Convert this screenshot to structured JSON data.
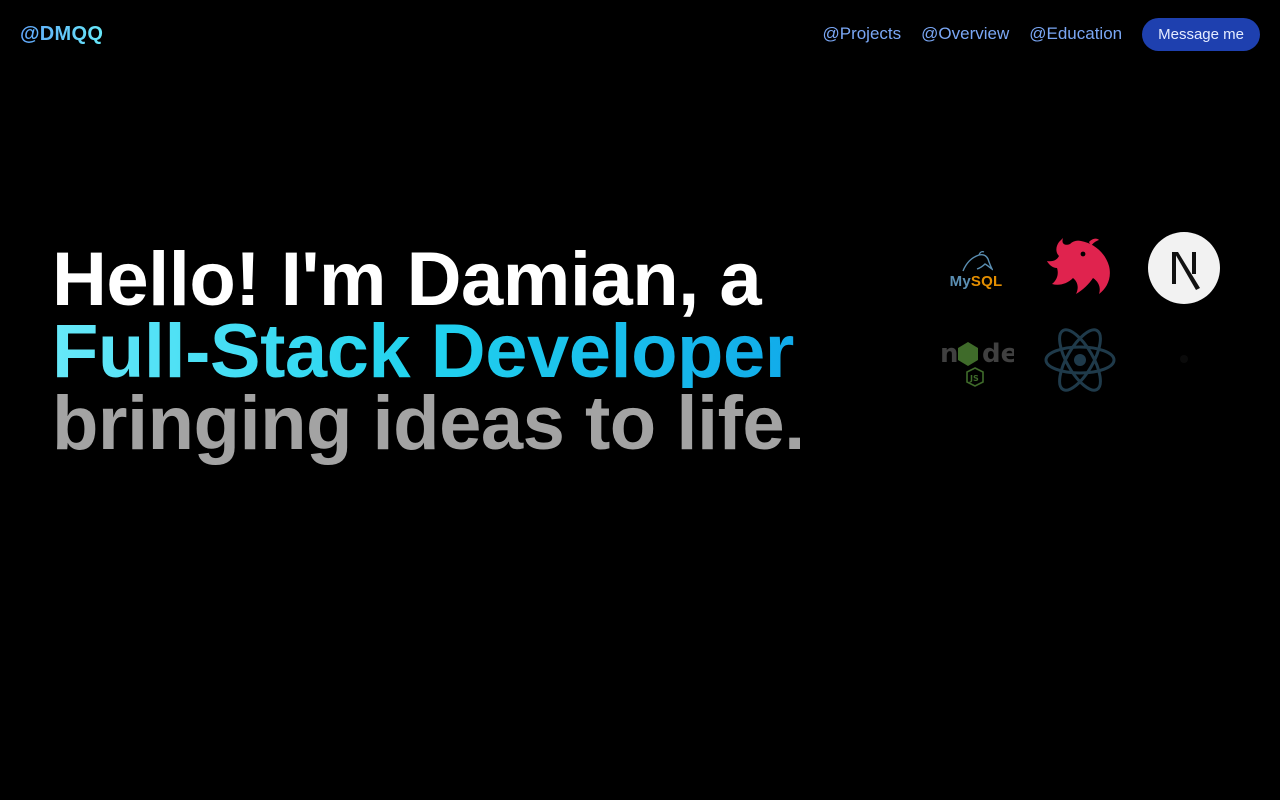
{
  "header": {
    "brand": "@DMQQ",
    "nav": [
      {
        "label": "@Projects"
      },
      {
        "label": "@Overview"
      },
      {
        "label": "@Education"
      }
    ],
    "cta_label": "Message me"
  },
  "hero": {
    "line1": "Hello! I'm Damian, a",
    "line2": "Full-Stack Developer",
    "line3": "bringing ideas to life."
  },
  "tech_icons": [
    {
      "name": "mysql-icon",
      "text_my": "My",
      "text_sql": "SQL"
    },
    {
      "name": "nestjs-icon"
    },
    {
      "name": "nextjs-icon"
    },
    {
      "name": "node-icon",
      "text": "node",
      "badge": "JS"
    },
    {
      "name": "react-icon"
    },
    {
      "name": "faded-icon"
    }
  ],
  "colors": {
    "background": "#000000",
    "accent": "#22d3ee",
    "nav_link": "#7aa7f5",
    "cta_bg": "#1e40af",
    "muted_text": "#a3a3a3",
    "nest_red": "#e0234e"
  }
}
